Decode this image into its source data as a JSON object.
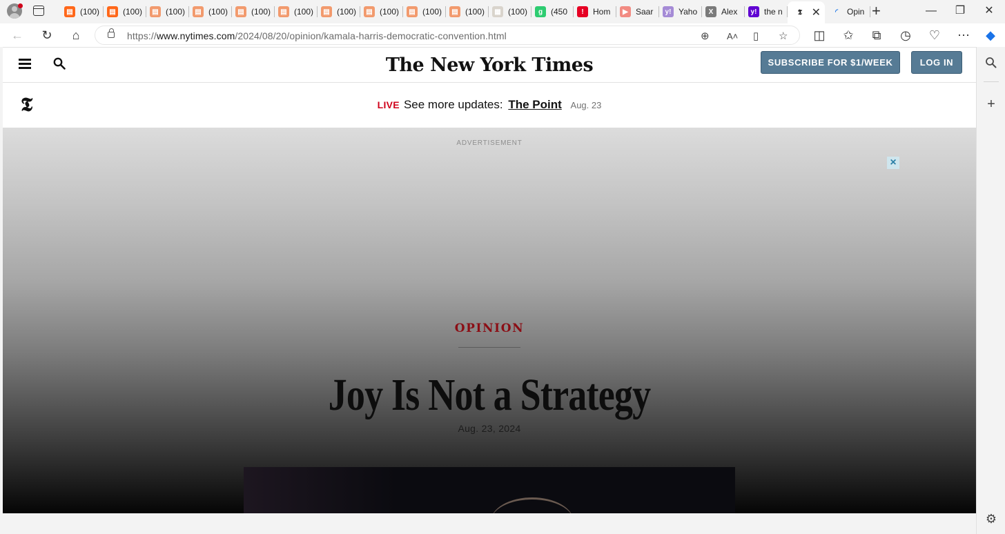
{
  "browser": {
    "tabs": [
      {
        "label": "(100)",
        "favicon": "substack-icon",
        "color": "#ff6719"
      },
      {
        "label": "(100)",
        "favicon": "substack-icon",
        "color": "#ff6719"
      },
      {
        "label": "(100)",
        "favicon": "substack-icon",
        "color": "#f29a6d"
      },
      {
        "label": "(100)",
        "favicon": "substack-icon",
        "color": "#f29a6d"
      },
      {
        "label": "(100)",
        "favicon": "substack-icon",
        "color": "#f29a6d"
      },
      {
        "label": "(100)",
        "favicon": "substack-icon",
        "color": "#f29a6d"
      },
      {
        "label": "(100)",
        "favicon": "substack-icon",
        "color": "#f29a6d"
      },
      {
        "label": "(100)",
        "favicon": "substack-icon",
        "color": "#f29a6d"
      },
      {
        "label": "(100)",
        "favicon": "substack-icon",
        "color": "#f29a6d"
      },
      {
        "label": "(100)",
        "favicon": "substack-icon",
        "color": "#f29a6d"
      },
      {
        "label": "(100)",
        "favicon": "image-icon",
        "color": "#d9d4cc"
      },
      {
        "label": "(450",
        "favicon": "green-g-icon",
        "color": "#2ecc71"
      },
      {
        "label": "Hom",
        "favicon": "red-icon",
        "color": "#e60023"
      },
      {
        "label": "Saar",
        "favicon": "youtube-icon",
        "color": "#f28b82"
      },
      {
        "label": "Yaho",
        "favicon": "yahoo-icon",
        "color": "#a58bd6"
      },
      {
        "label": "Alex",
        "favicon": "x-icon",
        "color": "#7a7a7a"
      },
      {
        "label": "the n",
        "favicon": "yahoo-icon",
        "color": "#6001d2"
      },
      {
        "label": "",
        "favicon": "nyt-icon",
        "color": "#121212",
        "active": true
      },
      {
        "label": "Opin",
        "favicon": "loading-icon",
        "color": "#1a73e8"
      }
    ],
    "url_prefix": "https://",
    "url_domain": "www.nytimes.com",
    "url_path": "/2024/08/20/opinion/kamala-harris-democratic-convention.html"
  },
  "nyt": {
    "masthead": "The New York Times",
    "subscribe_label": "SUBSCRIBE FOR $1/WEEK",
    "login_label": "LOG IN",
    "t_logo": "𝕿",
    "live_label": "LIVE",
    "live_text": "See more updates:",
    "live_link": "The Point",
    "live_date": "Aug. 23"
  },
  "article": {
    "ad_label": "ADVERTISEMENT",
    "section": "OPINION",
    "headline": "Joy Is Not a Strategy",
    "date": "Aug. 23, 2024"
  },
  "colors": {
    "accent_button": "#567b95",
    "live_red": "#d0021b",
    "opinion_red": "#8b0e15"
  }
}
